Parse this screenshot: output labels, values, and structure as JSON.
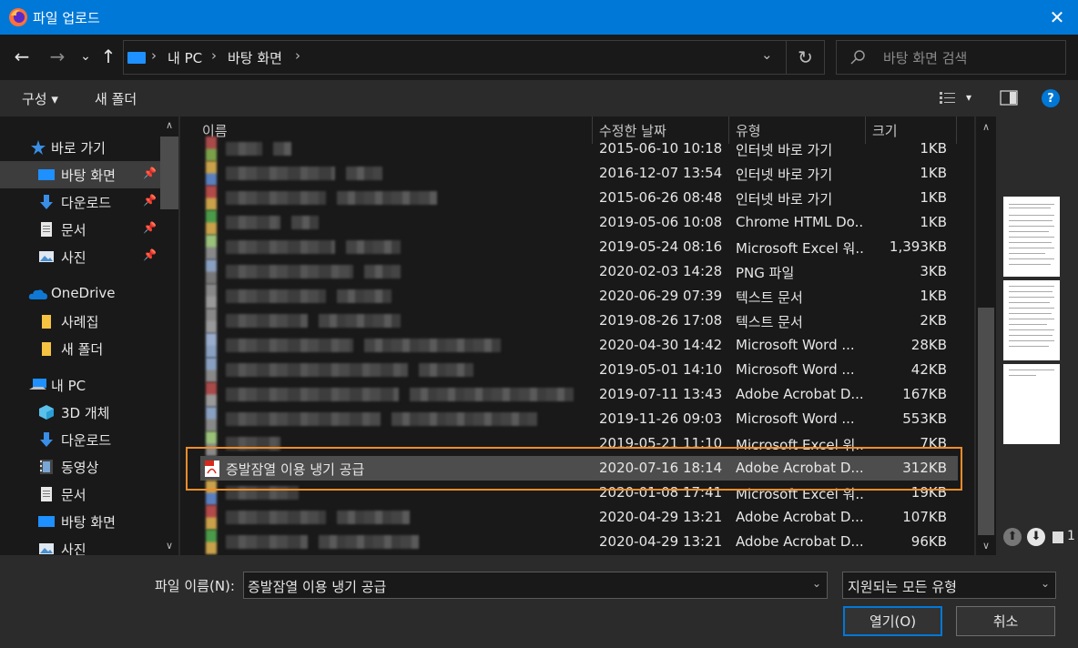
{
  "window": {
    "title": "파일 업로드",
    "close_glyph": "✕"
  },
  "nav": {
    "back_glyph": "←",
    "forward_glyph": "→",
    "recent_glyph": "⌄",
    "up_glyph": "↑",
    "breadcrumbs": [
      "내 PC",
      "바탕 화면"
    ],
    "sep_glyph": "›",
    "dropdown_glyph": "⌄",
    "refresh_glyph": "↻",
    "search_placeholder": "바탕 화면 검색"
  },
  "toolbar": {
    "organize": "구성 ▾",
    "new_folder": "새 폴더",
    "view_dropdown": "▾",
    "help_glyph": "?"
  },
  "sidebar": {
    "items": [
      {
        "label": "바로 가기",
        "icon": "star-icon",
        "pinned": false
      },
      {
        "label": "바탕 화면",
        "icon": "desktop-icon",
        "pinned": true
      },
      {
        "label": "다운로드",
        "icon": "download-icon",
        "pinned": true
      },
      {
        "label": "문서",
        "icon": "document-icon",
        "pinned": true
      },
      {
        "label": "사진",
        "icon": "picture-icon",
        "pinned": true
      },
      {
        "label": "OneDrive",
        "icon": "cloud-icon",
        "pinned": false
      },
      {
        "label": "사례집",
        "icon": "folder-icon",
        "pinned": false
      },
      {
        "label": "새 폴더",
        "icon": "folder-icon",
        "pinned": false
      },
      {
        "label": "내 PC",
        "icon": "computer-icon",
        "pinned": false
      },
      {
        "label": "3D 개체",
        "icon": "cube-icon",
        "pinned": false
      },
      {
        "label": "다운로드",
        "icon": "download-icon",
        "pinned": false
      },
      {
        "label": "동영상",
        "icon": "video-icon",
        "pinned": false
      },
      {
        "label": "문서",
        "icon": "document-icon",
        "pinned": false
      },
      {
        "label": "바탕 화면",
        "icon": "desktop-icon",
        "pinned": false
      },
      {
        "label": "사진",
        "icon": "picture-icon",
        "pinned": false
      }
    ],
    "pin_glyph": "📌",
    "scroll_up": "∧",
    "scroll_down": "∨"
  },
  "columns": {
    "name": "이름",
    "modified": "수정한 날짜",
    "type": "유형",
    "size": "크기",
    "sort_glyph": "⌃"
  },
  "files": [
    {
      "modified": "2015-06-10 10:18",
      "type": "인터넷 바로 가기",
      "size": "1KB"
    },
    {
      "modified": "2016-12-07 13:54",
      "type": "인터넷 바로 가기",
      "size": "1KB"
    },
    {
      "modified": "2015-06-26 08:48",
      "type": "인터넷 바로 가기",
      "size": "1KB"
    },
    {
      "modified": "2019-05-06 10:08",
      "type": "Chrome HTML Do...",
      "size": "1KB"
    },
    {
      "modified": "2019-05-24 08:16",
      "type": "Microsoft Excel 워...",
      "size": "1,393KB"
    },
    {
      "modified": "2020-02-03 14:28",
      "type": "PNG 파일",
      "size": "3KB"
    },
    {
      "modified": "2020-06-29 07:39",
      "type": "텍스트 문서",
      "size": "1KB"
    },
    {
      "modified": "2019-08-26 17:08",
      "type": "텍스트 문서",
      "size": "2KB"
    },
    {
      "modified": "2020-04-30 14:42",
      "type": "Microsoft Word ...",
      "size": "28KB"
    },
    {
      "modified": "2019-05-01 14:10",
      "type": "Microsoft Word ...",
      "size": "42KB"
    },
    {
      "modified": "2019-07-11 13:43",
      "type": "Adobe Acrobat D...",
      "size": "167KB"
    },
    {
      "modified": "2019-11-26 09:03",
      "type": "Microsoft Word ...",
      "size": "553KB"
    },
    {
      "modified": "2019-05-21 11:10",
      "type": "Microsoft Excel 워...",
      "size": "7KB"
    },
    {
      "name": "증발잠열 이용 냉기 공급",
      "modified": "2020-07-16 18:14",
      "type": "Adobe Acrobat D...",
      "size": "312KB",
      "selected": true
    },
    {
      "modified": "2020-01-08 17:41",
      "type": "Microsoft Excel 워...",
      "size": "19KB"
    },
    {
      "modified": "2020-04-29 13:21",
      "type": "Adobe Acrobat D...",
      "size": "107KB"
    },
    {
      "modified": "2020-04-29 13:21",
      "type": "Adobe Acrobat D...",
      "size": "96KB"
    }
  ],
  "footer": {
    "filename_label": "파일 이름(N):",
    "filename_value": "증발잠열 이용 냉기 공급",
    "filetype_value": "지원되는 모든 유형",
    "dropdown_glyph": "⌄",
    "open_label": "열기(O)",
    "cancel_label": "취소"
  },
  "preview_page_count_glyph": "1",
  "colors": {
    "accent": "#0078d7",
    "highlight": "#f08c2a",
    "bg": "#191919"
  }
}
